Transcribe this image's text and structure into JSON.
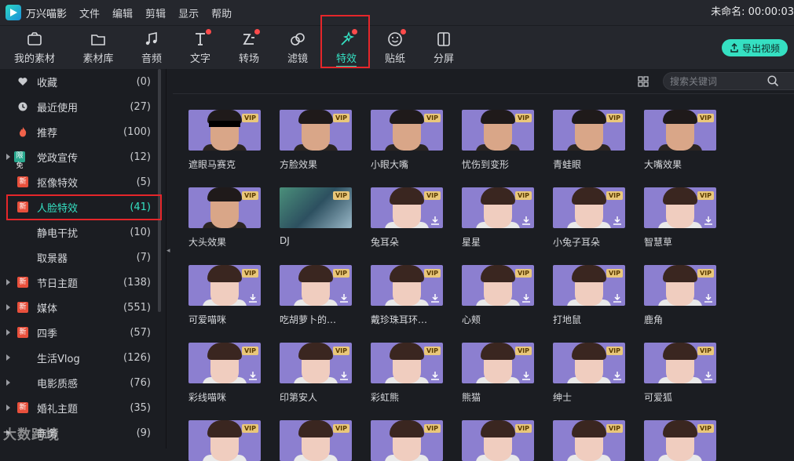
{
  "menubar": {
    "app_name": "万兴喵影",
    "items": [
      "文件",
      "编辑",
      "剪辑",
      "显示",
      "帮助"
    ],
    "project_title": "未命名: 00:00:03"
  },
  "toolbar": {
    "tabs": [
      {
        "label": "我的素材",
        "icon": "folder-media-icon",
        "dot": false
      },
      {
        "label": "素材库",
        "icon": "folder-icon",
        "dot": false
      },
      {
        "label": "音频",
        "icon": "music-note-icon",
        "dot": false
      },
      {
        "label": "文字",
        "icon": "text-icon",
        "dot": true
      },
      {
        "label": "转场",
        "icon": "transition-icon",
        "dot": true
      },
      {
        "label": "滤镜",
        "icon": "filter-icon",
        "dot": false
      },
      {
        "label": "特效",
        "icon": "magic-wand-icon",
        "dot": true,
        "active": true
      },
      {
        "label": "贴纸",
        "icon": "sticker-icon",
        "dot": true
      },
      {
        "label": "分屏",
        "icon": "split-screen-icon",
        "dot": false
      }
    ],
    "export_label": "导出视频",
    "accent": "#35e0c2",
    "highlight_color": "#e5262a"
  },
  "sidebar": {
    "items": [
      {
        "label": "收藏",
        "count": "(0)",
        "icon": "heart-icon"
      },
      {
        "label": "最近使用",
        "count": "(27)",
        "icon": "clock-icon"
      },
      {
        "label": "推荐",
        "count": "(100)",
        "icon": "flame-icon"
      },
      {
        "label": "党政宣传",
        "count": "(12)",
        "badge": "限免",
        "expandable": true
      },
      {
        "label": "抠像特效",
        "count": "(5)",
        "badge": "新"
      },
      {
        "label": "人脸特效",
        "count": "(41)",
        "badge": "新",
        "active": true
      },
      {
        "label": "静电干扰",
        "count": "(10)"
      },
      {
        "label": "取景器",
        "count": "(7)"
      },
      {
        "label": "节日主题",
        "count": "(138)",
        "badge": "新",
        "expandable": true
      },
      {
        "label": "媒体",
        "count": "(551)",
        "badge": "新",
        "expandable": true
      },
      {
        "label": "四季",
        "count": "(57)",
        "badge": "新",
        "expandable": true
      },
      {
        "label": "生活Vlog",
        "count": "(126)",
        "expandable": true
      },
      {
        "label": "电影质感",
        "count": "(76)",
        "expandable": true
      },
      {
        "label": "婚礼主题",
        "count": "(35)",
        "badge": "新",
        "expandable": true
      },
      {
        "label": "商务",
        "count": "(9)",
        "expandable": true
      }
    ]
  },
  "search": {
    "placeholder": "搜索关键词"
  },
  "effects": [
    {
      "title": "遮眼马赛克",
      "style": "man",
      "bar": true,
      "download": false
    },
    {
      "title": "方脸效果",
      "style": "man",
      "download": false
    },
    {
      "title": "小眼大嘴",
      "style": "man",
      "download": false
    },
    {
      "title": "忧伤到变形",
      "style": "man",
      "download": false
    },
    {
      "title": "青蛙眼",
      "style": "man",
      "download": false
    },
    {
      "title": "大嘴效果",
      "style": "man",
      "download": false
    },
    {
      "title": "大头效果",
      "style": "man",
      "download": false
    },
    {
      "title": "DJ",
      "style": "dj",
      "download": false
    },
    {
      "title": "兔耳朵",
      "style": "girl",
      "download": true
    },
    {
      "title": "星星",
      "style": "girl",
      "download": true
    },
    {
      "title": "小兔子耳朵",
      "style": "girl",
      "download": true
    },
    {
      "title": "智慧草",
      "style": "girl",
      "download": true
    },
    {
      "title": "可爱喵咪",
      "style": "girl",
      "download": true
    },
    {
      "title": "吃胡萝卜的…",
      "style": "girl",
      "download": true
    },
    {
      "title": "戴珍珠耳环…",
      "style": "girl",
      "download": true
    },
    {
      "title": "心颊",
      "style": "girl",
      "download": true
    },
    {
      "title": "打地鼠",
      "style": "girl",
      "download": true
    },
    {
      "title": "鹿角",
      "style": "girl",
      "download": true
    },
    {
      "title": "彩线喵咪",
      "style": "girl",
      "download": true
    },
    {
      "title": "印第安人",
      "style": "girl",
      "download": true
    },
    {
      "title": "彩虹熊",
      "style": "girl",
      "download": true
    },
    {
      "title": "熊猫",
      "style": "girl",
      "download": true
    },
    {
      "title": "绅士",
      "style": "girl",
      "download": true
    },
    {
      "title": "可爱狐",
      "style": "girl",
      "download": true
    },
    {
      "title": "",
      "style": "girl",
      "download": false
    },
    {
      "title": "",
      "style": "girl",
      "download": false
    },
    {
      "title": "",
      "style": "girl",
      "download": false
    },
    {
      "title": "",
      "style": "girl",
      "download": false
    },
    {
      "title": "",
      "style": "girl",
      "download": false
    },
    {
      "title": "",
      "style": "girl",
      "download": false
    }
  ],
  "vip_label": "VIP",
  "watermark": "大数跨境"
}
